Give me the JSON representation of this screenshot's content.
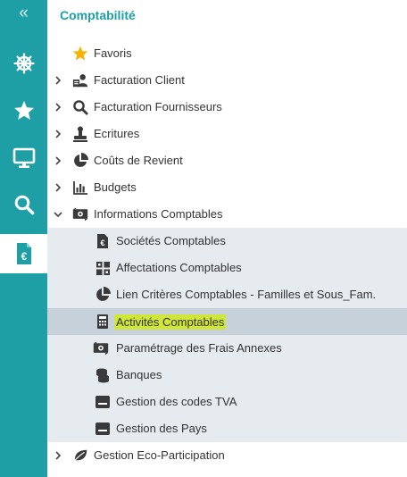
{
  "sidebar": {
    "collapse_glyph": "«",
    "items": [
      {
        "icon": "ship-wheel-icon"
      },
      {
        "icon": "star-icon"
      },
      {
        "icon": "monitor-icon"
      },
      {
        "icon": "search-icon"
      },
      {
        "icon": "euro-document-icon",
        "active": true
      }
    ]
  },
  "panel": {
    "title": "Comptabilité",
    "items": [
      {
        "label": "Favoris",
        "icon": "star-icon"
      },
      {
        "label": "Facturation Client",
        "icon": "user-card-icon"
      },
      {
        "label": "Facturation Fournisseurs",
        "icon": "search-icon"
      },
      {
        "label": "Ecritures",
        "icon": "stamp-icon"
      },
      {
        "label": "Coûts de Revient",
        "icon": "pie-chart-icon"
      },
      {
        "label": "Budgets",
        "icon": "bar-chart-icon"
      },
      {
        "label": "Informations Comptables",
        "icon": "money-icon",
        "expanded": true
      },
      {
        "label": "Sociétés Comptables",
        "icon": "euro-document-icon"
      },
      {
        "label": "Affectations Comptables",
        "icon": "grid-icon"
      },
      {
        "label": "Lien Critères Comptables - Familles et Sous_Fam.",
        "icon": "pie-chart-icon"
      },
      {
        "label": "Activités Comptables",
        "icon": "calculator-icon",
        "selected": true
      },
      {
        "label": "Paramétrage des Frais Annexes",
        "icon": "money-icon"
      },
      {
        "label": "Banques",
        "icon": "coins-icon"
      },
      {
        "label": "Gestion des codes TVA",
        "icon": "card-icon"
      },
      {
        "label": "Gestion des Pays",
        "icon": "card-icon"
      },
      {
        "label": "Gestion Eco-Participation",
        "icon": "leaf-icon"
      }
    ]
  },
  "colors": {
    "accent": "#1e9fa6",
    "highlight": "#cfe63a",
    "submenu_bg": "#e6ebef",
    "selected_bg": "#c7d1da",
    "favorite_star": "#f5b400"
  }
}
